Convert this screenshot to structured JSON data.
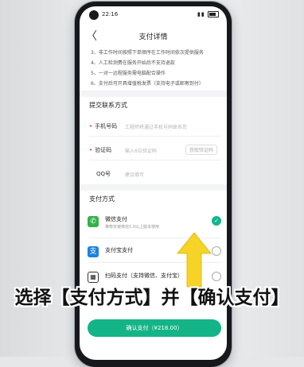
{
  "status_bar": {
    "time": "22:16"
  },
  "header": {
    "back_glyph": "〈",
    "title": "支付详情"
  },
  "notes": [
    "3、非工作时间按照下单顺序在工作时间依次提供服务",
    "4、人工检测费在服务开始后不支持退款",
    "5、一对一远程服务需电脑配合操作",
    "6、支付后可开具增值税发票（支持电子或邮寄到付）"
  ],
  "contact": {
    "section_title": "提交联系方式",
    "phone_label": "手机号码",
    "phone_placeholder": "工程师将通过手机号码联系您",
    "code_label": "验证码",
    "code_placeholder": "输入6位验证码",
    "code_button": "获取验证码",
    "qq_label": "QQ号",
    "qq_placeholder": "建议填写"
  },
  "payment": {
    "section_title": "支付方式",
    "methods": [
      {
        "name": "微信支付",
        "sub": "推荐安装微信5.0以上版本使用",
        "icon": "wechat-icon",
        "selected": true
      },
      {
        "name": "支付宝支付",
        "sub": "",
        "icon": "alipay-icon",
        "selected": false
      },
      {
        "name": "扫码支付（支持微信、支付宝）",
        "sub": "",
        "icon": "qr-code-icon",
        "selected": false
      }
    ],
    "confirm_button": "确认支付（¥218.00）"
  },
  "caption": "选择【支付方式】并【确认支付】",
  "colors": {
    "accent": "#15b487",
    "arrow": "#f5d327",
    "wechat": "#34b24a",
    "alipay": "#1a82e0"
  }
}
